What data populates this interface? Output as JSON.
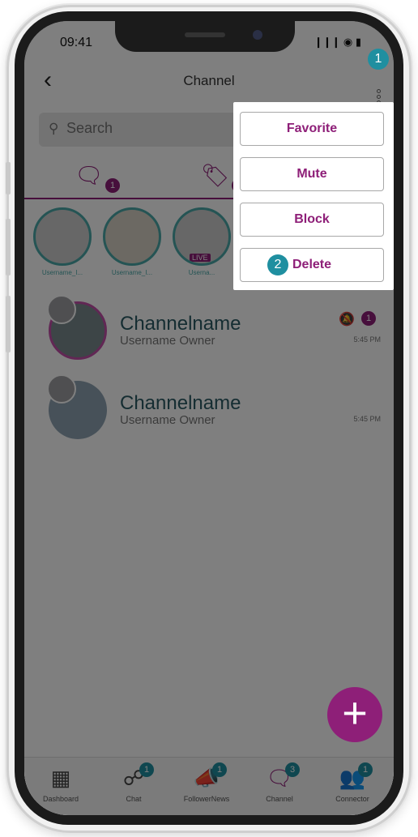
{
  "status_bar": {
    "time": "09:41",
    "icons": "❙❙❙ ◉ ▮"
  },
  "header": {
    "back": "‹",
    "title": "Channel"
  },
  "search": {
    "placeholder": "Search",
    "icon": "search-icon"
  },
  "tabs": [
    {
      "name": "chats",
      "icon": "chat-bubble-icon",
      "badge": "1"
    },
    {
      "name": "favorites",
      "icon": "heart-tag-icon",
      "badge": "1"
    }
  ],
  "stories": [
    {
      "name": "Username_I...",
      "live": false
    },
    {
      "name": "Username_I...",
      "live": false
    },
    {
      "name": "Userna...",
      "live": true,
      "live_label": "LIVE"
    }
  ],
  "channels": [
    {
      "name": "Channelname",
      "owner": "Username Owner",
      "time": "5:45 PM",
      "muted": true,
      "unread": "1"
    },
    {
      "name": "Channelname",
      "owner": "Username Owner",
      "time": "5:45 PM",
      "muted": false,
      "unread": ""
    }
  ],
  "menu": {
    "items": [
      {
        "label": "Favorite"
      },
      {
        "label": "Mute"
      },
      {
        "label": "Block"
      },
      {
        "label": "Delete"
      }
    ]
  },
  "step_badges": {
    "first": "1",
    "second": "2"
  },
  "fab": {
    "label": "+"
  },
  "bottom_nav": [
    {
      "label": "Dashboard",
      "icon": "dashboard-icon",
      "badge": ""
    },
    {
      "label": "Chat",
      "icon": "chat-network-icon",
      "badge": "1"
    },
    {
      "label": "FollowerNews",
      "icon": "megaphone-icon",
      "badge": "1"
    },
    {
      "label": "Channel",
      "icon": "channel-icon",
      "badge": "3"
    },
    {
      "label": "Connector",
      "icon": "connector-icon",
      "badge": "1"
    }
  ],
  "colors": {
    "accent": "#8e1f78",
    "teal": "#1f8fa0",
    "overlay": "rgba(0,0,0,0.5)"
  }
}
